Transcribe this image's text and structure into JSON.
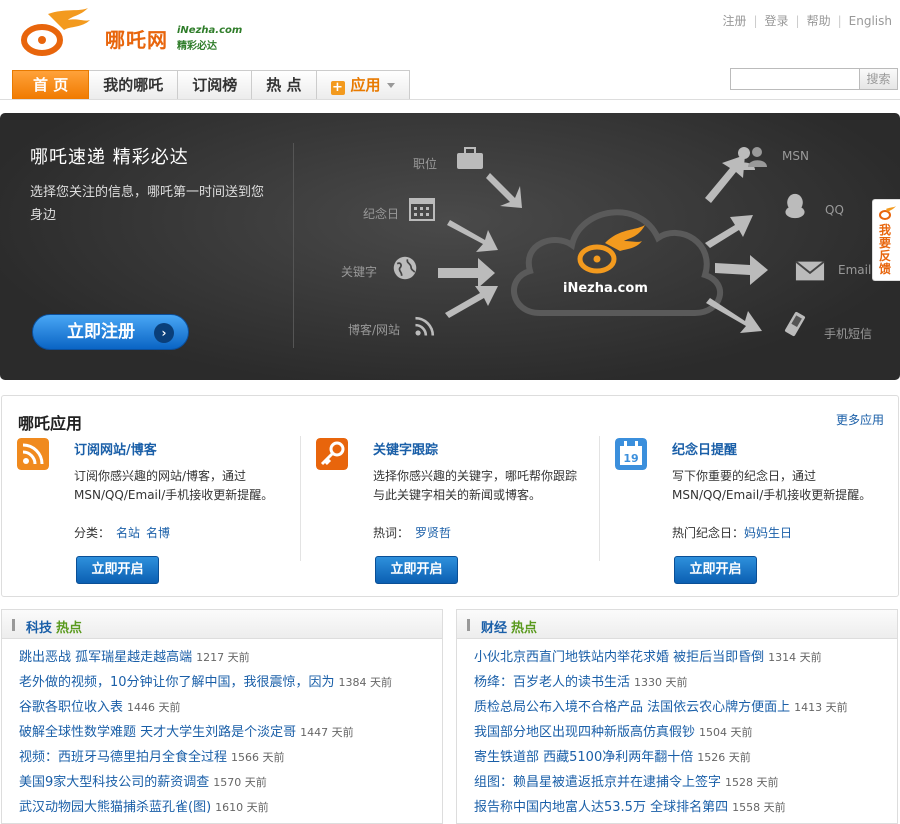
{
  "brand": {
    "name_cn": "哪吒网",
    "name_en": "iNezha.com",
    "slogan": "精彩必达",
    "accent": "#f07a00",
    "link_color": "#1a5fa8"
  },
  "toplinks": [
    "注册",
    "登录",
    "帮助",
    "English"
  ],
  "nav": {
    "tabs": [
      "首 页",
      "我的哪吒",
      "订阅榜",
      "热 点",
      "应用"
    ],
    "active": "首 页"
  },
  "search": {
    "button_label": "搜索",
    "placeholder": ""
  },
  "banner": {
    "title": "哪吒速递  精彩必达",
    "description": "选择您关注的信息，哪吒第一时间送到您身边",
    "register_button": "立即注册",
    "cloud_label": "iNezha.com",
    "inputs": [
      {
        "label": "职位",
        "icon": "briefcase-icon"
      },
      {
        "label": "纪念日",
        "icon": "calendar-icon"
      },
      {
        "label": "关键字",
        "icon": "globe-icon"
      },
      {
        "label": "博客/网站",
        "icon": "rss-icon"
      }
    ],
    "outputs": [
      {
        "label": "MSN",
        "icon": "msn-users-icon"
      },
      {
        "label": "QQ",
        "icon": "qq-penguin-icon"
      },
      {
        "label": "Email",
        "icon": "envelope-icon"
      },
      {
        "label": "手机短信",
        "icon": "mobile-phone-icon"
      }
    ]
  },
  "apps": {
    "title": "哪吒应用",
    "more": "更多应用",
    "items": [
      {
        "name": "订阅网站/博客",
        "icon": "rss-icon",
        "desc": "订阅你感兴趣的网站/博客，通过MSN/QQ/Email/手机接收更新提醒。",
        "tag_label": "分类：",
        "tags": [
          "名站",
          "名博"
        ],
        "button": "立即开启"
      },
      {
        "name": "关键字跟踪",
        "icon": "key-icon",
        "desc": "选择你感兴趣的关键字，哪吒帮你跟踪与此关键字相关的新闻或博客。",
        "tag_label": "热词：",
        "tags": [
          "罗贤哲"
        ],
        "button": "立即开启"
      },
      {
        "name": "纪念日提醒",
        "icon": "calendar-icon",
        "calendar_day": "19",
        "desc": "写下你重要的纪念日，通过MSN/QQ/Email/手机接收更新提醒。",
        "tag_label": "热门纪念日：",
        "tags": [
          "妈妈生日"
        ],
        "button": "立即开启"
      }
    ]
  },
  "hot_tech": {
    "title": "科技",
    "suffix": "热点",
    "items": [
      {
        "title": "跳出恶战 孤军瑞星越走越高端",
        "time": "1217 天前"
      },
      {
        "title": "老外做的视频，10分钟让你了解中国，我很震惊，因为",
        "time": "1384 天前"
      },
      {
        "title": "谷歌各职位收入表",
        "time": "1446 天前"
      },
      {
        "title": "破解全球性数学难题 天才大学生刘路是个淡定哥",
        "time": "1447 天前"
      },
      {
        "title": "视频：西班牙马德里拍月全食全过程",
        "time": "1566 天前"
      },
      {
        "title": "美国9家大型科技公司的薪资调查",
        "time": "1570 天前"
      },
      {
        "title": "武汉动物园大熊猫捕杀蓝孔雀(图)",
        "time": "1610 天前"
      }
    ]
  },
  "hot_finance": {
    "title": "财经",
    "suffix": "热点",
    "items": [
      {
        "title": "小伙北京西直门地铁站内举花求婚 被拒后当即昏倒",
        "time": "1314 天前"
      },
      {
        "title": "杨绛：百岁老人的读书生活",
        "time": "1330 天前"
      },
      {
        "title": "质检总局公布入境不合格产品 法国依云农心牌方便面上",
        "time": "1413 天前"
      },
      {
        "title": "我国部分地区出现四种新版高仿真假钞",
        "time": "1504 天前"
      },
      {
        "title": "寄生铁道部 西藏5100净利两年翻十倍",
        "time": "1526 天前"
      },
      {
        "title": "组图：赖昌星被遣返抵京并在逮捕令上签字",
        "time": "1528 天前"
      },
      {
        "title": "报告称中国内地富人达53.5万 全球排名第四",
        "time": "1558 天前"
      }
    ]
  },
  "feedback": "我要反馈"
}
